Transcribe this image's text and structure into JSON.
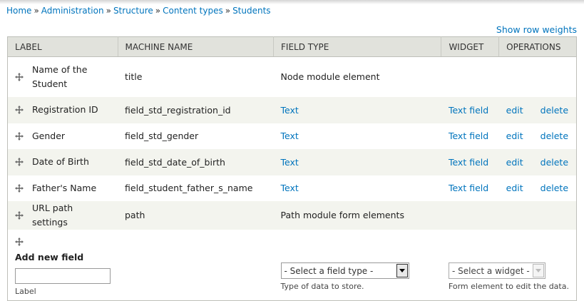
{
  "breadcrumb": {
    "items": [
      "Home",
      "Administration",
      "Structure",
      "Content types",
      "Students"
    ],
    "separator": "»"
  },
  "show_row_weights": "Show row weights",
  "table": {
    "headers": [
      "LABEL",
      "MACHINE NAME",
      "FIELD TYPE",
      "WIDGET",
      "OPERATIONS"
    ],
    "rows": [
      {
        "label": "Name of the Student",
        "machine_name": "title",
        "field_type": "Node module element",
        "field_type_link": false,
        "widget": "",
        "edit": "",
        "delete": ""
      },
      {
        "label": "Registration ID",
        "machine_name": "field_std_registration_id",
        "field_type": "Text",
        "field_type_link": true,
        "widget": "Text field",
        "edit": "edit",
        "delete": "delete"
      },
      {
        "label": "Gender",
        "machine_name": "field_std_gender",
        "field_type": "Text",
        "field_type_link": true,
        "widget": "Text field",
        "edit": "edit",
        "delete": "delete"
      },
      {
        "label": "Date of Birth",
        "machine_name": "field_std_date_of_birth",
        "field_type": "Text",
        "field_type_link": true,
        "widget": "Text field",
        "edit": "edit",
        "delete": "delete"
      },
      {
        "label": "Father's Name",
        "machine_name": "field_student_father_s_name",
        "field_type": "Text",
        "field_type_link": true,
        "widget": "Text field",
        "edit": "edit",
        "delete": "delete"
      },
      {
        "label": "URL path settings",
        "machine_name": "path",
        "field_type": "Path module form elements",
        "field_type_link": false,
        "widget": "",
        "edit": "",
        "delete": ""
      }
    ]
  },
  "add_new_field": {
    "title": "Add new field",
    "label_value": "",
    "label_caption": "Label",
    "field_type_select": "- Select a field type -",
    "field_type_desc": "Type of data to store.",
    "widget_select": "- Select a widget -",
    "widget_desc": "Form element to edit the data."
  },
  "colors": {
    "link": "#0074bd",
    "header_bg": "#e1e2dc",
    "even_row_bg": "#f3f4ee",
    "border": "#bebfb9"
  },
  "icons": {
    "drag": "move-arrows-icon",
    "dropdown": "triangle-down-icon"
  }
}
